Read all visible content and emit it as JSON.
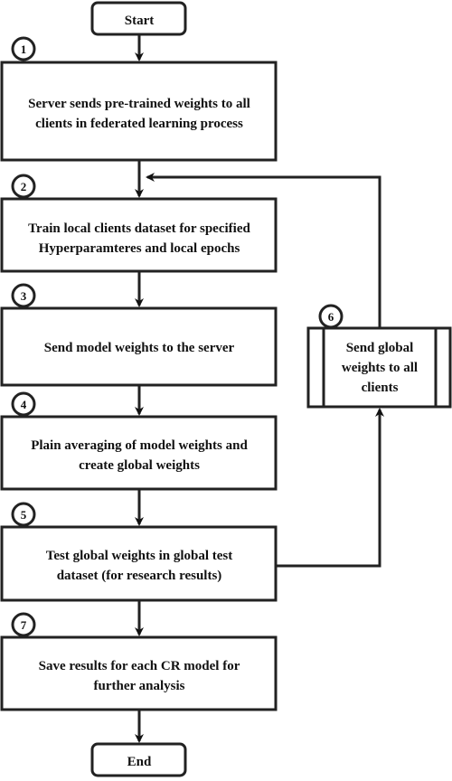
{
  "start": "Start",
  "end": "End",
  "steps": [
    {
      "num": "1",
      "lines": [
        "Server sends pre-trained weights to all",
        "clients in federated learning process"
      ]
    },
    {
      "num": "2",
      "lines": [
        "Train local clients dataset for specified",
        "Hyperparamteres and local epochs"
      ]
    },
    {
      "num": "3",
      "lines": [
        "Send model weights to the server"
      ]
    },
    {
      "num": "4",
      "lines": [
        "Plain averaging of model weights and",
        "create global weights"
      ]
    },
    {
      "num": "5",
      "lines": [
        "Test global weights in global test",
        "dataset (for research results)"
      ]
    },
    {
      "num": "6",
      "lines": [
        "Send global",
        "weights to all",
        "clients"
      ]
    },
    {
      "num": "7",
      "lines": [
        "Save results for each CR model for",
        "further analysis"
      ]
    }
  ]
}
